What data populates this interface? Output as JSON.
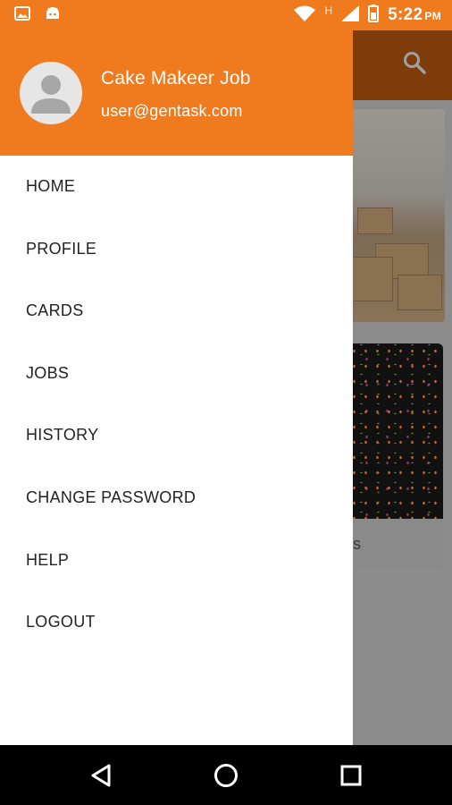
{
  "status_bar": {
    "time": "5:22",
    "ampm": "PM",
    "network_label": "H",
    "accent": "#f07a1e"
  },
  "drawer": {
    "user_name": "Cake Makeer Job",
    "user_email": "user@gentask.com",
    "menu": [
      {
        "label": "HOME",
        "icon": "home"
      },
      {
        "label": "PROFILE",
        "icon": "profile"
      },
      {
        "label": "CARDS",
        "icon": "cards"
      },
      {
        "label": "JOBS",
        "icon": "jobs"
      },
      {
        "label": "HISTORY",
        "icon": "history"
      },
      {
        "label": "CHANGE PASSWORD",
        "icon": "change-password"
      },
      {
        "label": "HELP",
        "icon": "help"
      },
      {
        "label": "LOGOUT",
        "icon": "logout"
      }
    ]
  },
  "background": {
    "card_caption_fragment": "ts"
  },
  "colors": {
    "header": "#f07a1e",
    "background_dim": "#8c8c8c",
    "nav_bar": "#000000"
  }
}
